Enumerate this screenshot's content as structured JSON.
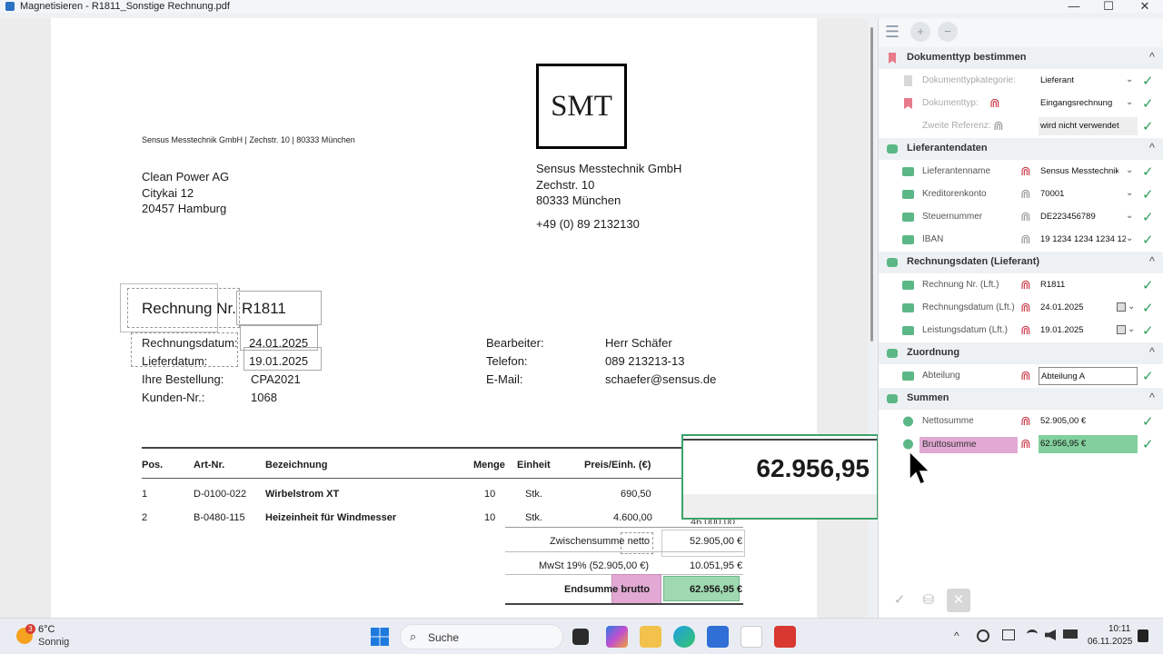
{
  "window": {
    "title": "Magnetisieren - R1811_Sonstige Rechnung.pdf",
    "minimize": "—",
    "maximize": "☐",
    "close": "✕"
  },
  "invoice": {
    "sender_line": "Sensus Messtechnik GmbH |  Zechstr. 10 | 80333 München",
    "logo_text": "SMT",
    "recipient": [
      "Clean Power AG",
      "Citykai 12",
      "20457 Hamburg"
    ],
    "sender": [
      "Sensus Messtechnik GmbH",
      "Zechstr. 10",
      "80333 München"
    ],
    "phone_main": "+49 (0) 89 2132130",
    "title_label": "Rechnung Nr.",
    "title_number": "R1811",
    "meta_left": [
      {
        "label": "Rechnungsdatum:",
        "value": "24.01.2025"
      },
      {
        "label": "Lieferdatum:",
        "value": "19.01.2025"
      },
      {
        "label": "Ihre Bestellung:",
        "value": "CPA2021"
      },
      {
        "label": "Kunden-Nr.:",
        "value": "1068"
      }
    ],
    "meta_right": [
      {
        "label": "Bearbeiter:",
        "value": "Herr Schäfer"
      },
      {
        "label": "Telefon:",
        "value": "089 213213-13"
      },
      {
        "label": "E-Mail:",
        "value": "schaefer@sensus.de"
      }
    ],
    "table_headers": {
      "pos": "Pos.",
      "art": "Art-Nr.",
      "desc": "Bezeichnung",
      "qty": "Menge",
      "unit": "Einheit",
      "price": "Preis/Einh. (€)"
    },
    "rows": [
      {
        "pos": "1",
        "art": "D-0100-022",
        "desc": "Wirbelstrom XT",
        "qty": "10",
        "unit": "Stk.",
        "price": "690,50"
      },
      {
        "pos": "2",
        "art": "B-0480-115",
        "desc": "Heizeinheit für Windmesser",
        "qty": "10",
        "unit": "Stk.",
        "price": "4.600,00",
        "total_partial": "46.000,00"
      }
    ],
    "subtotal_label": "Zwischensumme netto",
    "subtotal_value": "52.905,00 €",
    "vat_label": "MwSt 19% (52.905,00 €)",
    "vat_value": "10.051,95 €",
    "total_label": "Endsumme brutto",
    "total_value": "62.956,95 €"
  },
  "magnifier": {
    "value": "62.956,95"
  },
  "panel": {
    "toolbar": {
      "list_icon": "☰",
      "zoom_in_icon": "+",
      "zoom_out_icon": "−"
    },
    "sections": {
      "doctype": {
        "title": "Dokumenttyp bestimmen",
        "rows": [
          {
            "label": "Dokumenttypkategorie:",
            "value": "Lieferant"
          },
          {
            "label": "Dokumenttyp:",
            "value": "Eingangsrechnung"
          },
          {
            "label": "Zweite Referenz:",
            "value": "wird nicht verwendet"
          }
        ]
      },
      "supplier": {
        "title": "Lieferantendaten",
        "rows": [
          {
            "label": "Lieferantenname",
            "value": "Sensus Messtechnik GmbH"
          },
          {
            "label": "Kreditorenkonto",
            "value": "70001"
          },
          {
            "label": "Steuernummer",
            "value": "DE223456789"
          },
          {
            "label": "IBAN",
            "value": "19 1234 1234 1234 12"
          }
        ]
      },
      "invoicedata": {
        "title": "Rechnungsdaten (Lieferant)",
        "rows": [
          {
            "label": "Rechnung Nr. (Lft.)",
            "value": "R1811"
          },
          {
            "label": "Rechnungsdatum (Lft.)",
            "value": "24.01.2025"
          },
          {
            "label": "Leistungsdatum (Lft.)",
            "value": "19.01.2025"
          }
        ]
      },
      "assignment": {
        "title": "Zuordnung",
        "rows": [
          {
            "label": "Abteilung",
            "value": "Abteilung A"
          }
        ]
      },
      "sums": {
        "title": "Summen",
        "rows": [
          {
            "label": "Nettosumme",
            "value": "52.905,00 €"
          },
          {
            "label": "Bruttosumme",
            "value": "62.956,95 €"
          }
        ]
      }
    },
    "caret": "^",
    "check": "✓",
    "dropdown": "⌄",
    "magnet": "⋒",
    "bottom": {
      "confirm_icon": "✓",
      "save_icon": "⛁",
      "cancel_icon": "✕"
    }
  },
  "taskbar": {
    "weather_badge": "3",
    "temperature": "6°C",
    "weather": "Sonnig",
    "search_icon": "⌕",
    "search_label": "Suche",
    "tray_up": "^",
    "time": "10:11",
    "date": "06.11.2025"
  },
  "colors": {
    "accent_green": "#3ca36a",
    "field_green": "#83cf9d",
    "pink_highlight": "#e1a9d3",
    "magnet_red": "#cc3b4b"
  }
}
